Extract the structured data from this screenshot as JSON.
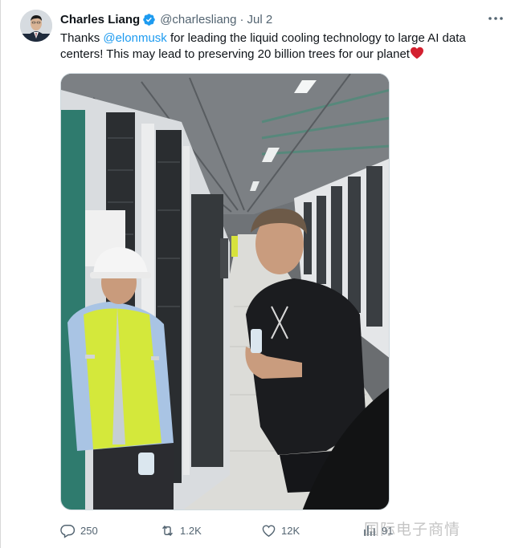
{
  "tweet": {
    "author_name": "Charles Liang",
    "handle": "@charlesliang",
    "separator": "·",
    "date": "Jul 2",
    "text_before": "Thanks ",
    "mention": "@elonmusk",
    "text_after": " for leading the liquid cooling technology to large AI data centers! This may lead to preserving 20 billion trees for our planet",
    "more_label": "···"
  },
  "actions": {
    "replies": "250",
    "retweets": "1.2K",
    "likes": "12K",
    "views": "91"
  },
  "watermark": "国际电子商情",
  "colors": {
    "accent": "#1d9bf0",
    "text": "#0f1419",
    "muted": "#536471",
    "heart": "#d3202f"
  },
  "icons": [
    "verified-badge-icon",
    "more-icon",
    "heart-emoji-icon",
    "reply-icon",
    "retweet-icon",
    "like-icon",
    "views-icon"
  ]
}
